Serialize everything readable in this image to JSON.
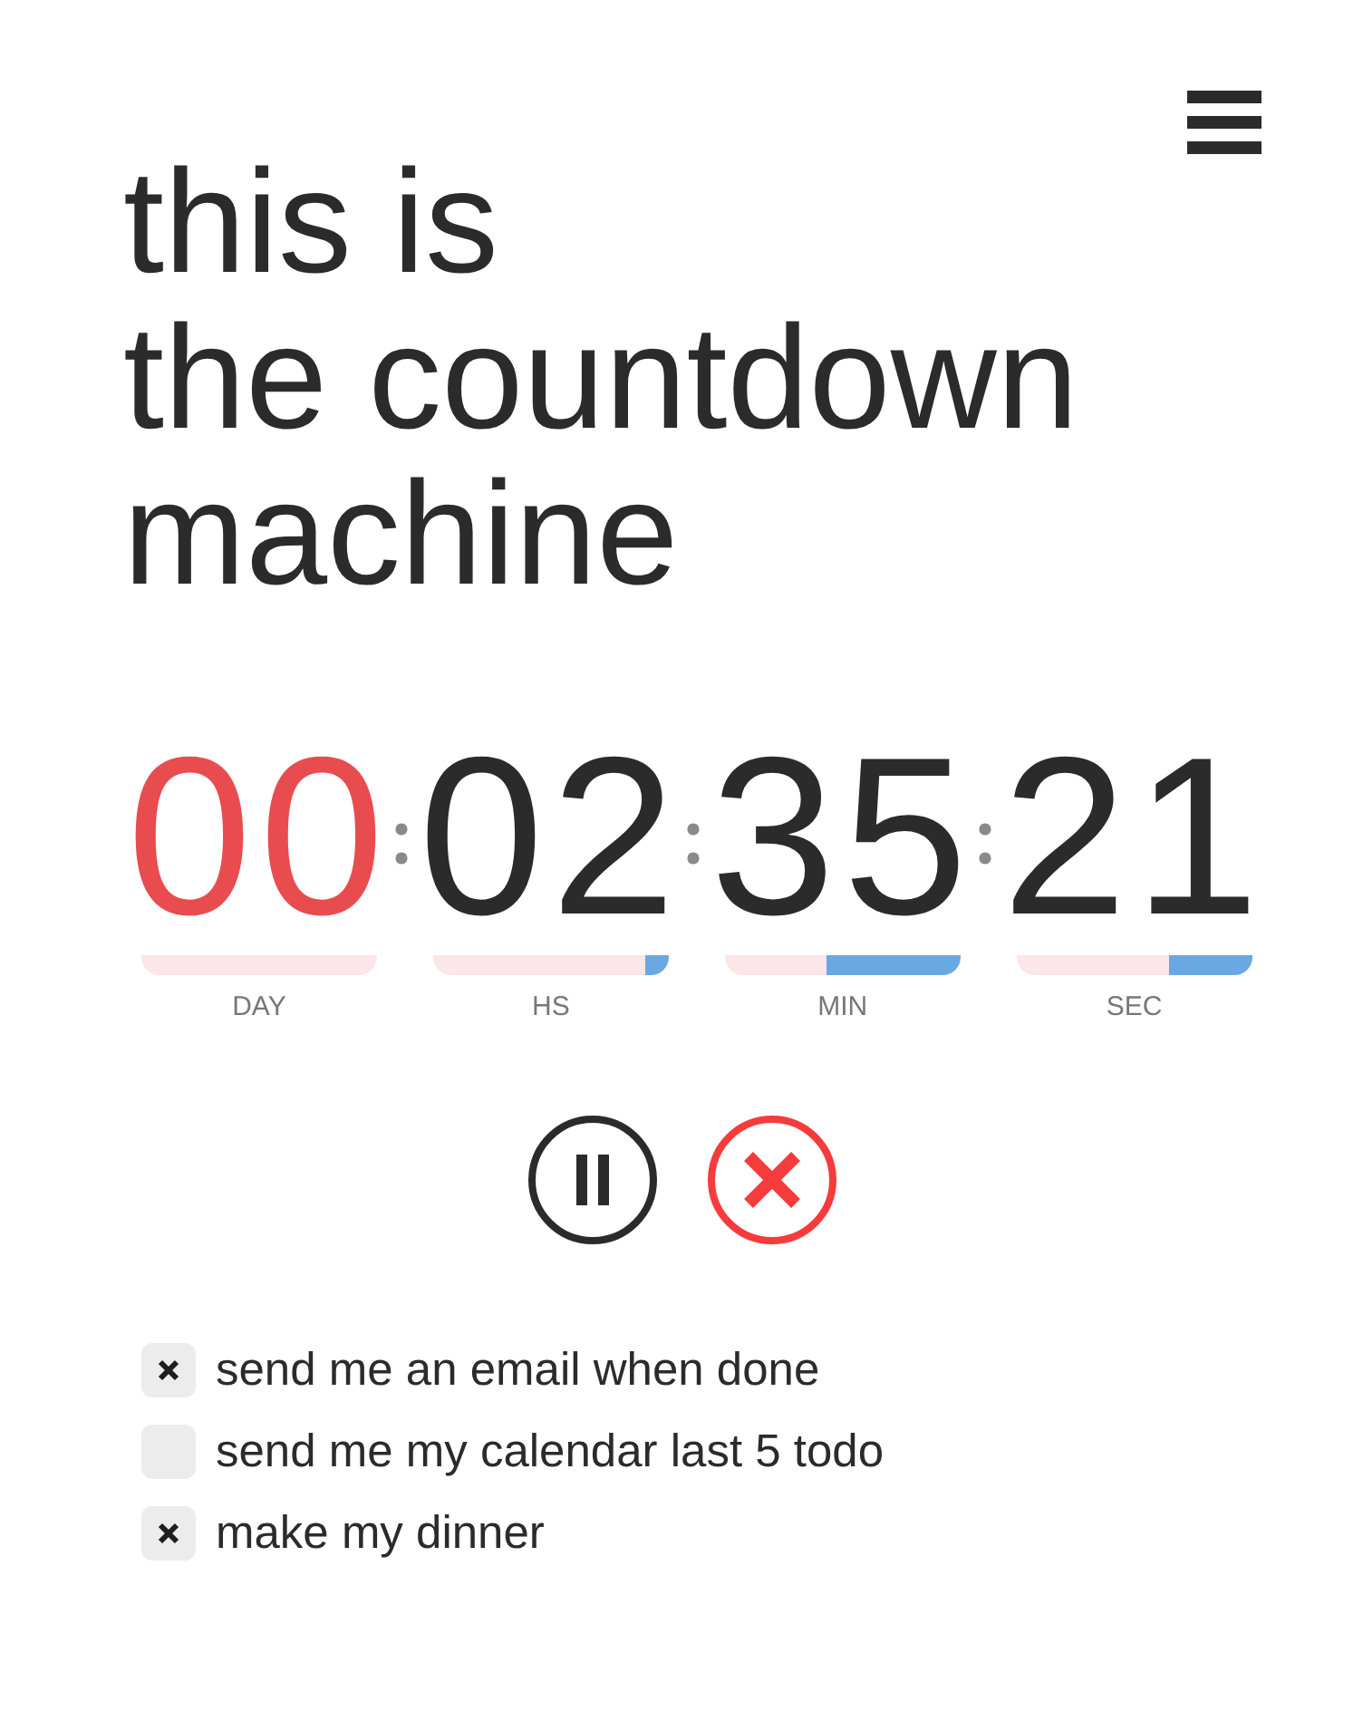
{
  "title_lines": [
    "this is",
    "the countdown",
    "machine"
  ],
  "countdown": {
    "units": [
      {
        "value": "00",
        "label": "DAY",
        "color": "#e84c4f"
      },
      {
        "value": "02",
        "label": "HS",
        "level": 0.1,
        "color": "#2b2b2b"
      },
      {
        "value": "35",
        "label": "MIN",
        "level": 0.57,
        "color": "#2b2b2b"
      },
      {
        "value": "21",
        "label": "SEC",
        "level": 0.35,
        "color": "#2b2b2b"
      }
    ]
  },
  "options": [
    {
      "label": "send me an email when done",
      "checked": true
    },
    {
      "label": "send me my calendar last 5 todo",
      "checked": false
    },
    {
      "label": "make my dinner",
      "checked": true
    }
  ]
}
